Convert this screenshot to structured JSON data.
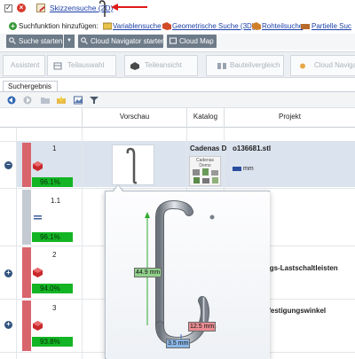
{
  "toolbar_top": {
    "sketch_search_label": "Skizzensuche (2D)",
    "add_label": "Suchfunktion hinzufügen:",
    "links": [
      {
        "label": "Variablensuche",
        "icon": "variable-search-icon"
      },
      {
        "label": "Geometrische Suche (3D)",
        "icon": "geometric-search-icon"
      },
      {
        "label": "Rohteilsuche",
        "icon": "raw-part-icon"
      },
      {
        "label": "Partielle Suc",
        "icon": "partial-search-icon"
      }
    ]
  },
  "buttons": {
    "start_search": "Suche starten",
    "cloud_navigator_start": "Cloud Navigator starten",
    "cloud_map": "Cloud Map"
  },
  "tabs": [
    {
      "label": "Assistent",
      "icon": ""
    },
    {
      "label": "Teilauswahl",
      "icon": "part-select-icon"
    },
    {
      "label": "Teileansicht",
      "icon": "part-view-icon"
    },
    {
      "label": "Bauteilvergleich",
      "icon": "compare-icon"
    },
    {
      "label": "Cloud Navigator",
      "icon": "cloud-icon"
    }
  ],
  "results_tab": "Suchergebnis",
  "columns": {
    "preview": "Vorschau",
    "catalog": "Katalog",
    "project": "Projekt"
  },
  "rows": [
    {
      "num": "1",
      "pct": "96.1%",
      "catalog": "Cadenas D",
      "catalog_logo_text": "Cadenas Demo",
      "project": "o136681.stl",
      "unit": "mm"
    },
    {
      "num": "1.1",
      "pct": "96.1%"
    },
    {
      "num": "2",
      "pct": "94.0%",
      "project": "ungs-Lastschaltleisten"
    },
    {
      "num": "3",
      "pct": "93.8%",
      "project": "Befestigungswinkel"
    }
  ],
  "popup": {
    "dim1": "44.9 mm",
    "dim2": "12.5 mm",
    "dim3": "3.5 mm"
  },
  "colors": {
    "match_bar": "#13b524",
    "score_red": "#d9656c",
    "toolbar_button": "#6d7a88",
    "selection": "#dbe3ee",
    "link": "#1a3ea8"
  }
}
